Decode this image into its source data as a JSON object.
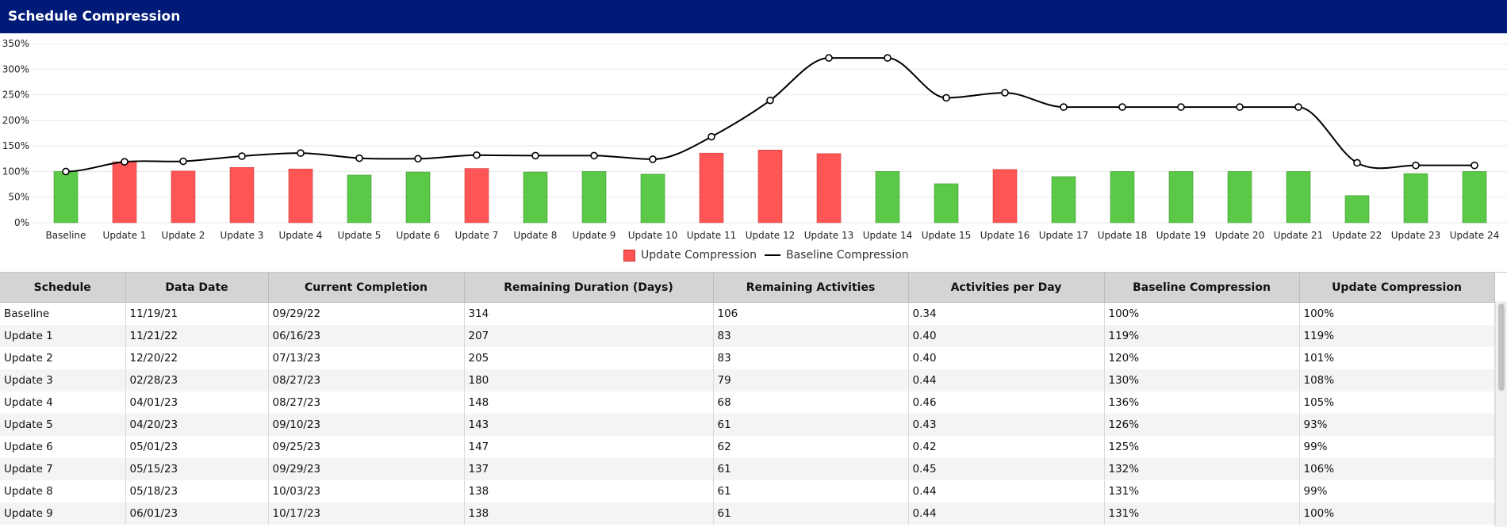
{
  "header": {
    "title": "Schedule Compression"
  },
  "chart_data": {
    "type": "bar+line",
    "categories": [
      "Baseline",
      "Update 1",
      "Update 2",
      "Update 3",
      "Update 4",
      "Update 5",
      "Update 6",
      "Update 7",
      "Update 8",
      "Update 9",
      "Update 10",
      "Update 11",
      "Update 12",
      "Update 13",
      "Update 14",
      "Update 15",
      "Update 16",
      "Update 17",
      "Update 18",
      "Update 19",
      "Update 20",
      "Update 21",
      "Update 22",
      "Update 23",
      "Update 24"
    ],
    "series": [
      {
        "name": "Update Compression",
        "type": "bar",
        "values": [
          100,
          119,
          101,
          108,
          105,
          93,
          99,
          106,
          99,
          100,
          95,
          136,
          142,
          135,
          100,
          76,
          104,
          90,
          100,
          100,
          100,
          100,
          53,
          96,
          100
        ]
      },
      {
        "name": "Baseline Compression",
        "type": "line",
        "values": [
          100,
          119,
          120,
          130,
          136,
          126,
          125,
          132,
          131,
          131,
          124,
          168,
          239,
          322,
          322,
          244,
          254,
          226,
          226,
          226,
          226,
          226,
          117,
          112,
          112
        ]
      }
    ],
    "ylim": [
      0,
      350
    ],
    "yticks": [
      "0%",
      "50%",
      "100%",
      "150%",
      "200%",
      "250%",
      "300%",
      "350%"
    ],
    "bar_colors": {
      "above": "#ff5555",
      "at_or_below": "#5bc847"
    },
    "line_color": "#000000",
    "legend_placement": "bottom-center",
    "grid": true
  },
  "table": {
    "columns": [
      "Schedule",
      "Data Date",
      "Current Completion",
      "Remaining Duration (Days)",
      "Remaining Activities",
      "Activities per Day",
      "Baseline Compression",
      "Update Compression"
    ],
    "rows": [
      [
        "Baseline",
        "11/19/21",
        "09/29/22",
        "314",
        "106",
        "0.34",
        "100%",
        "100%"
      ],
      [
        "Update 1",
        "11/21/22",
        "06/16/23",
        "207",
        "83",
        "0.40",
        "119%",
        "119%"
      ],
      [
        "Update 2",
        "12/20/22",
        "07/13/23",
        "205",
        "83",
        "0.40",
        "120%",
        "101%"
      ],
      [
        "Update 3",
        "02/28/23",
        "08/27/23",
        "180",
        "79",
        "0.44",
        "130%",
        "108%"
      ],
      [
        "Update 4",
        "04/01/23",
        "08/27/23",
        "148",
        "68",
        "0.46",
        "136%",
        "105%"
      ],
      [
        "Update 5",
        "04/20/23",
        "09/10/23",
        "143",
        "61",
        "0.43",
        "126%",
        "93%"
      ],
      [
        "Update 6",
        "05/01/23",
        "09/25/23",
        "147",
        "62",
        "0.42",
        "125%",
        "99%"
      ],
      [
        "Update 7",
        "05/15/23",
        "09/29/23",
        "137",
        "61",
        "0.45",
        "132%",
        "106%"
      ],
      [
        "Update 8",
        "05/18/23",
        "10/03/23",
        "138",
        "61",
        "0.44",
        "131%",
        "99%"
      ],
      [
        "Update 9",
        "06/01/23",
        "10/17/23",
        "138",
        "61",
        "0.44",
        "131%",
        "100%"
      ]
    ]
  }
}
